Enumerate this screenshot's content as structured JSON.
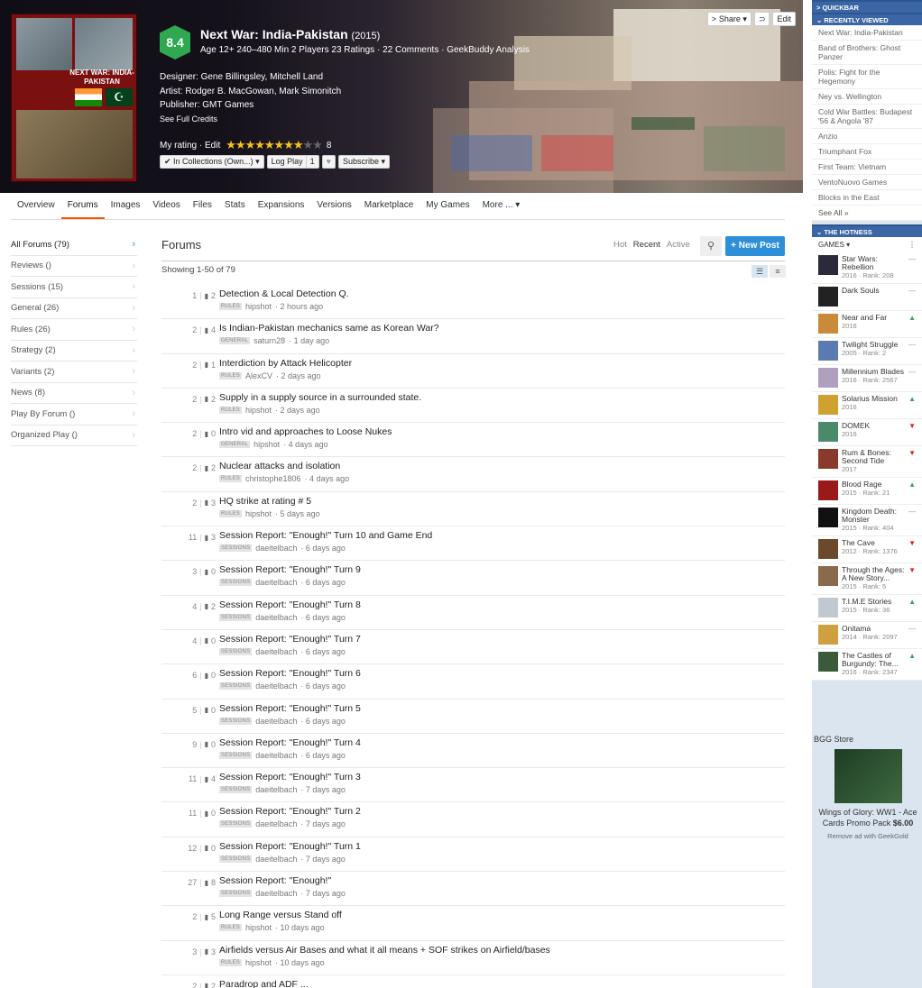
{
  "header": {
    "rating": "8.4",
    "title": "Next War: India-Pakistan",
    "year": "(2015)",
    "meta": "Age 12+   240–480 Min   2 Players   23 Ratings · 22 Comments · GeekBuddy Analysis",
    "designer": "Designer:  Gene Billingsley, Mitchell Land",
    "artist": "Artist:  Rodger B. MacGowan, Mark Simonitch",
    "publisher": "Publisher:  GMT Games",
    "full_credits": "See Full Credits",
    "my_rating_label": "My rating · Edit",
    "my_rating_value": "8",
    "stars_on": 8,
    "stars_total": 10,
    "cover_title": "NEXT WAR: INDIA-PAKISTAN",
    "btn_collections": "✔ In Collections (Own...) ▾",
    "btn_logplay": "Log Play",
    "btn_logplay_count": "1",
    "btn_heart": "♥",
    "btn_subscribe": "Subscribe ▾",
    "btn_share": "Share ▾",
    "btn_edit": "Edit",
    "accent": "#ff5100",
    "rating_color": "#2fa84f"
  },
  "tabs": [
    "Overview",
    "Forums",
    "Images",
    "Videos",
    "Files",
    "Stats",
    "Expansions",
    "Versions",
    "Marketplace",
    "My Games",
    "More ... ▾"
  ],
  "forums_nav": [
    {
      "label": "All Forums (79)"
    },
    {
      "label": "Reviews ()"
    },
    {
      "label": "Sessions (15)"
    },
    {
      "label": "General (26)"
    },
    {
      "label": "Rules (26)"
    },
    {
      "label": "Strategy (2)"
    },
    {
      "label": "Variants (2)"
    },
    {
      "label": "News (8)"
    },
    {
      "label": "Play By Forum ()"
    },
    {
      "label": "Organized Play ()"
    }
  ],
  "forums": {
    "title": "Forums",
    "sort_hot": "Hot",
    "sort_recent": "Recent",
    "sort_active": "Active",
    "new_post": "+ New Post",
    "showing": "Showing 1-50 of 79"
  },
  "threads": [
    {
      "views": "1",
      "replies": "2",
      "title": "Detection & Local Detection Q.",
      "tag": "RULES",
      "user": "hipshot",
      "time": "· 2 hours ago"
    },
    {
      "views": "2",
      "replies": "4",
      "title": "Is Indian-Pakistan mechanics same as Korean War?",
      "tag": "GENERAL",
      "user": "saturn28",
      "time": "· 1 day ago"
    },
    {
      "views": "2",
      "replies": "1",
      "title": "Interdiction by Attack Helicopter",
      "tag": "RULES",
      "user": "AlexCV",
      "time": "· 2 days ago"
    },
    {
      "views": "2",
      "replies": "2",
      "title": "Supply in a supply source in a surrounded state.",
      "tag": "RULES",
      "user": "hipshot",
      "time": "· 2 days ago"
    },
    {
      "views": "2",
      "replies": "0",
      "title": "Intro vid and approaches to Loose Nukes",
      "tag": "GENERAL",
      "user": "hipshot",
      "time": "· 4 days ago"
    },
    {
      "views": "2",
      "replies": "2",
      "title": "Nuclear attacks and isolation",
      "tag": "RULES",
      "user": "christophe1806",
      "time": "· 4 days ago"
    },
    {
      "views": "2",
      "replies": "3",
      "title": "HQ strike at rating # 5",
      "tag": "RULES",
      "user": "hipshot",
      "time": "· 5 days ago"
    },
    {
      "views": "11",
      "replies": "3",
      "title": "Session Report: \"Enough!\" Turn 10 and Game End",
      "tag": "SESSIONS",
      "user": "daeitelbach",
      "time": "· 6 days ago"
    },
    {
      "views": "3",
      "replies": "0",
      "title": "Session Report: \"Enough!\" Turn 9",
      "tag": "SESSIONS",
      "user": "daeitelbach",
      "time": "· 6 days ago"
    },
    {
      "views": "4",
      "replies": "2",
      "title": "Session Report: \"Enough!\" Turn 8",
      "tag": "SESSIONS",
      "user": "daeitelbach",
      "time": "· 6 days ago"
    },
    {
      "views": "4",
      "replies": "0",
      "title": "Session Report: \"Enough!\" Turn 7",
      "tag": "SESSIONS",
      "user": "daeitelbach",
      "time": "· 6 days ago"
    },
    {
      "views": "6",
      "replies": "0",
      "title": "Session Report: \"Enough!\" Turn 6",
      "tag": "SESSIONS",
      "user": "daeitelbach",
      "time": "· 6 days ago"
    },
    {
      "views": "5",
      "replies": "0",
      "title": "Session Report: \"Enough!\" Turn 5",
      "tag": "SESSIONS",
      "user": "daeitelbach",
      "time": "· 6 days ago"
    },
    {
      "views": "9",
      "replies": "0",
      "title": "Session Report: \"Enough!\" Turn 4",
      "tag": "SESSIONS",
      "user": "daeitelbach",
      "time": "· 6 days ago"
    },
    {
      "views": "11",
      "replies": "4",
      "title": "Session Report: \"Enough!\" Turn 3",
      "tag": "SESSIONS",
      "user": "daeitelbach",
      "time": "· 7 days ago"
    },
    {
      "views": "11",
      "replies": "0",
      "title": "Session Report: \"Enough!\" Turn 2",
      "tag": "SESSIONS",
      "user": "daeitelbach",
      "time": "· 7 days ago"
    },
    {
      "views": "12",
      "replies": "0",
      "title": "Session Report: \"Enough!\" Turn 1",
      "tag": "SESSIONS",
      "user": "daeitelbach",
      "time": "· 7 days ago"
    },
    {
      "views": "27",
      "replies": "8",
      "title": "Session Report: \"Enough!\"",
      "tag": "SESSIONS",
      "user": "daeitelbach",
      "time": "· 7 days ago"
    },
    {
      "views": "2",
      "replies": "5",
      "title": "Long Range versus Stand off",
      "tag": "RULES",
      "user": "hipshot",
      "time": "· 10 days ago"
    },
    {
      "views": "3",
      "replies": "3",
      "title": "Airfields versus Air Bases and what it all means + SOF strikes on Airfield/bases",
      "tag": "RULES",
      "user": "hipshot",
      "time": "· 10 days ago"
    },
    {
      "views": "2",
      "replies": "2",
      "title": "Paradrop and ADF ...",
      "tag": "",
      "user": "",
      "time": ""
    }
  ],
  "sidebar": {
    "quickbar": "QUICKBAR",
    "recently_viewed": "RECENTLY VIEWED",
    "recent": [
      "Next War: India-Pakistan",
      "Band of Brothers: Ghost Panzer",
      "Polis: Fight for the Hegemony",
      "Ney vs. Wellington",
      "Cold War Battles: Budapest '56 & Angola '87",
      "Anzio",
      "Triumphant Fox",
      "First Team: Vietnam",
      "VentoNuovo Games",
      "Blocks in the East"
    ],
    "see_all": "See All »",
    "hotness": "THE HOTNESS",
    "games_label": "GAMES ▾",
    "hot": [
      {
        "name": "Star Wars: Rebellion",
        "meta": "2016 · Rank: 208",
        "trend": "flat",
        "color": "#2a2a3a"
      },
      {
        "name": "Dark Souls",
        "meta": "",
        "trend": "flat",
        "color": "#222"
      },
      {
        "name": "Near and Far",
        "meta": "2016",
        "trend": "up",
        "color": "#c98b3a"
      },
      {
        "name": "Twilight Struggle",
        "meta": "2005 · Rank: 2",
        "trend": "flat",
        "color": "#5a7ab0"
      },
      {
        "name": "Millennium Blades",
        "meta": "2016 · Rank: 2567",
        "trend": "flat",
        "color": "#b0a0c0"
      },
      {
        "name": "Solarius Mission",
        "meta": "2016",
        "trend": "up",
        "color": "#d0a030"
      },
      {
        "name": "DOMEK",
        "meta": "2016",
        "trend": "down",
        "color": "#4a8a6a"
      },
      {
        "name": "Rum & Bones: Second Tide",
        "meta": "2017",
        "trend": "down",
        "color": "#8a3a2a"
      },
      {
        "name": "Blood Rage",
        "meta": "2015 · Rank: 21",
        "trend": "up",
        "color": "#9a1a1a"
      },
      {
        "name": "Kingdom Death: Monster",
        "meta": "2015 · Rank: 404",
        "trend": "flat",
        "color": "#111"
      },
      {
        "name": "The Cave",
        "meta": "2012 · Rank: 1376",
        "trend": "down",
        "color": "#6a4a2a"
      },
      {
        "name": "Through the Ages: A New Story...",
        "meta": "2015 · Rank: 5",
        "trend": "down",
        "color": "#8a6a4a"
      },
      {
        "name": "T.I.M.E Stories",
        "meta": "2015 · Rank: 36",
        "trend": "up",
        "color": "#c0c8d0"
      },
      {
        "name": "Onitama",
        "meta": "2014 · Rank: 2097",
        "trend": "flat",
        "color": "#d0a040"
      },
      {
        "name": "The Castles of Burgundy: The...",
        "meta": "2016 · Rank: 2347",
        "trend": "up",
        "color": "#3a5a3a"
      }
    ],
    "store_label": "BGG Store",
    "store_product": "Wings of Glory: WW1 - Ace Cards Promo Pack",
    "store_price": "$6.00",
    "store_remove": "Remove ad with GeekGold"
  }
}
